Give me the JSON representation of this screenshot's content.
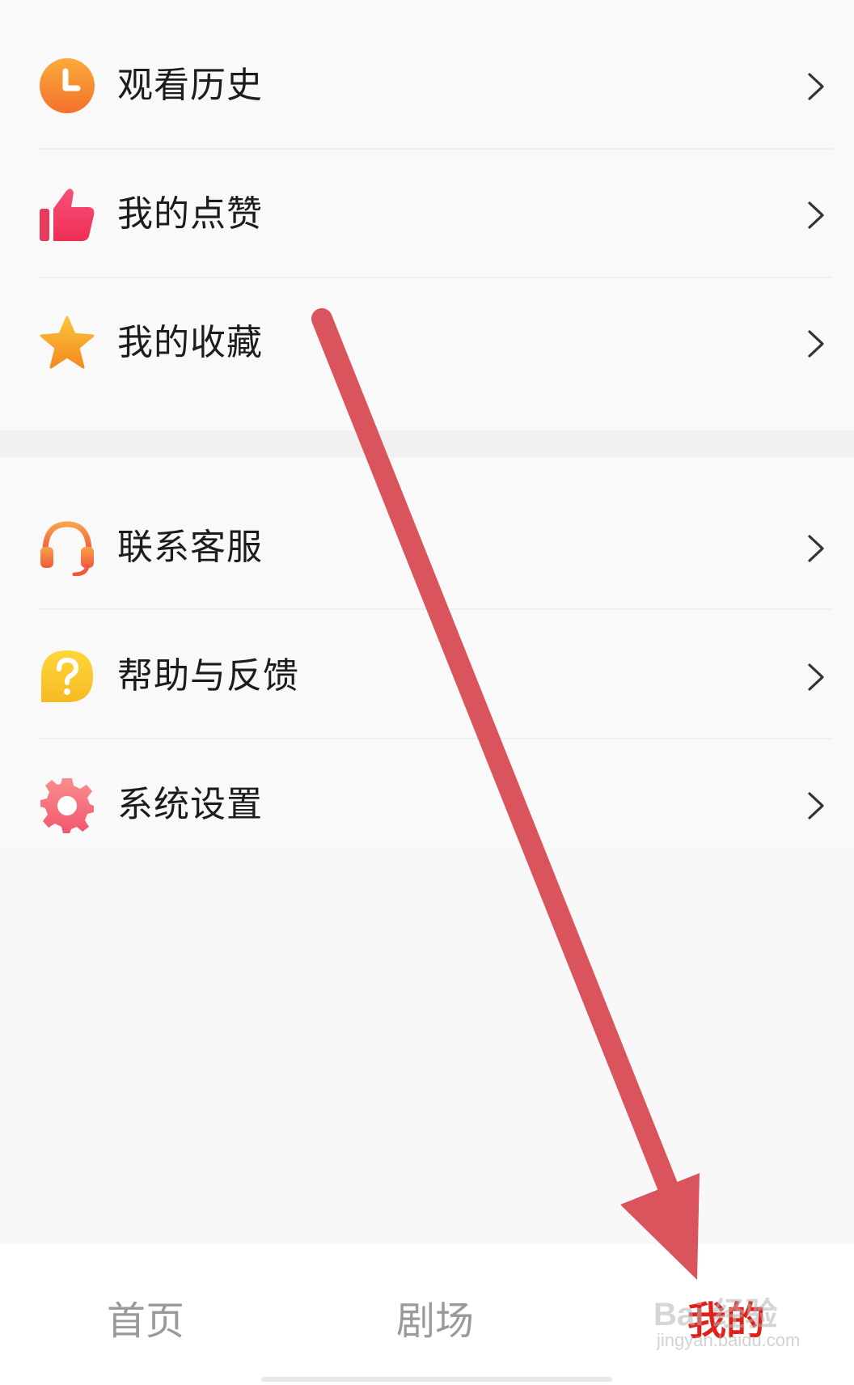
{
  "menu_group_1": {
    "items": [
      {
        "label": "观看历史",
        "icon": "clock-icon"
      },
      {
        "label": "我的点赞",
        "icon": "thumbs-up-icon"
      },
      {
        "label": "我的收藏",
        "icon": "star-icon"
      }
    ]
  },
  "menu_group_2": {
    "items": [
      {
        "label": "联系客服",
        "icon": "headset-icon"
      },
      {
        "label": "帮助与反馈",
        "icon": "question-bubble-icon"
      },
      {
        "label": "系统设置",
        "icon": "gear-icon"
      }
    ]
  },
  "tab_bar": {
    "tabs": [
      {
        "label": "首页",
        "active": false
      },
      {
        "label": "剧场",
        "active": false
      },
      {
        "label": "我的",
        "active": true
      }
    ]
  },
  "watermark": {
    "logo": "Bai 经验",
    "url": "jingyan.baidu.com"
  },
  "colors": {
    "active_tab": "#e0211a",
    "inactive_tab": "#9a9a9a",
    "annotation_arrow": "#d9545c",
    "clock_orange": "#f7892a",
    "thumb_pink": "#f5416a",
    "star_gold": "#f7a928",
    "headset_orange": "#f47a43",
    "question_yellow": "#f8c62e",
    "gear_pink": "#f56b7a"
  }
}
